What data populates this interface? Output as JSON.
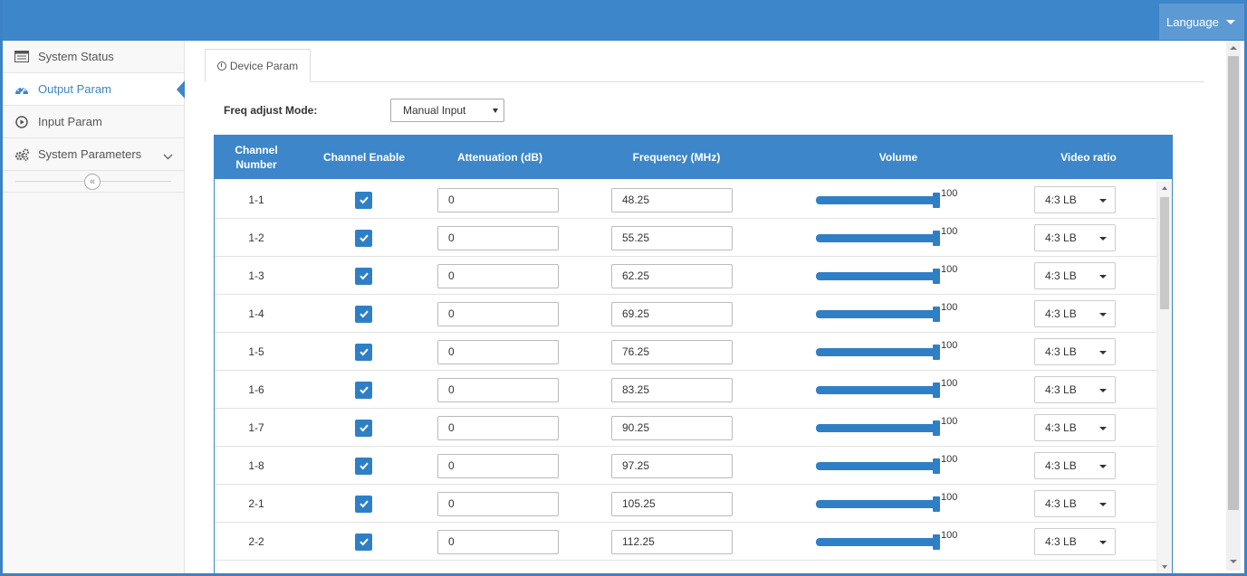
{
  "header": {
    "language_label": "Language"
  },
  "sidebar": {
    "items": [
      {
        "label": "System Status",
        "icon": "list-icon",
        "active": false
      },
      {
        "label": "Output Param",
        "icon": "dashboard-icon",
        "active": true
      },
      {
        "label": "Input Param",
        "icon": "play-circle-icon",
        "active": false
      },
      {
        "label": "System Parameters",
        "icon": "gears-icon",
        "active": false,
        "has_submenu": true
      }
    ],
    "collapse_icon": "double-chevron-left-icon"
  },
  "main": {
    "tab": {
      "label": "Device Param",
      "icon": "clock-icon"
    },
    "freq_mode": {
      "label": "Freq adjust Mode:",
      "value": "Manual Input"
    },
    "table": {
      "headers": {
        "channel_number": "Channel Number",
        "channel_enable": "Channel Enable",
        "attenuation": "Attenuation  (dB)",
        "frequency": "Frequency  (MHz)",
        "volume": "Volume",
        "video_ratio": "Video ratio"
      },
      "rows": [
        {
          "channel": "1-1",
          "enabled": true,
          "attenuation": "0",
          "frequency": "48.25",
          "volume": "100",
          "video_ratio": "4:3 LB"
        },
        {
          "channel": "1-2",
          "enabled": true,
          "attenuation": "0",
          "frequency": "55.25",
          "volume": "100",
          "video_ratio": "4:3 LB"
        },
        {
          "channel": "1-3",
          "enabled": true,
          "attenuation": "0",
          "frequency": "62.25",
          "volume": "100",
          "video_ratio": "4:3 LB"
        },
        {
          "channel": "1-4",
          "enabled": true,
          "attenuation": "0",
          "frequency": "69.25",
          "volume": "100",
          "video_ratio": "4:3 LB"
        },
        {
          "channel": "1-5",
          "enabled": true,
          "attenuation": "0",
          "frequency": "76.25",
          "volume": "100",
          "video_ratio": "4:3 LB"
        },
        {
          "channel": "1-6",
          "enabled": true,
          "attenuation": "0",
          "frequency": "83.25",
          "volume": "100",
          "video_ratio": "4:3 LB"
        },
        {
          "channel": "1-7",
          "enabled": true,
          "attenuation": "0",
          "frequency": "90.25",
          "volume": "100",
          "video_ratio": "4:3 LB"
        },
        {
          "channel": "1-8",
          "enabled": true,
          "attenuation": "0",
          "frequency": "97.25",
          "volume": "100",
          "video_ratio": "4:3 LB"
        },
        {
          "channel": "2-1",
          "enabled": true,
          "attenuation": "0",
          "frequency": "105.25",
          "volume": "100",
          "video_ratio": "4:3 LB"
        },
        {
          "channel": "2-2",
          "enabled": true,
          "attenuation": "0",
          "frequency": "112.25",
          "volume": "100",
          "video_ratio": "4:3 LB"
        }
      ]
    }
  },
  "colors": {
    "accent": "#3c86c9",
    "header_bg": "#3c86c9",
    "checkbox": "#2f7fc6"
  }
}
